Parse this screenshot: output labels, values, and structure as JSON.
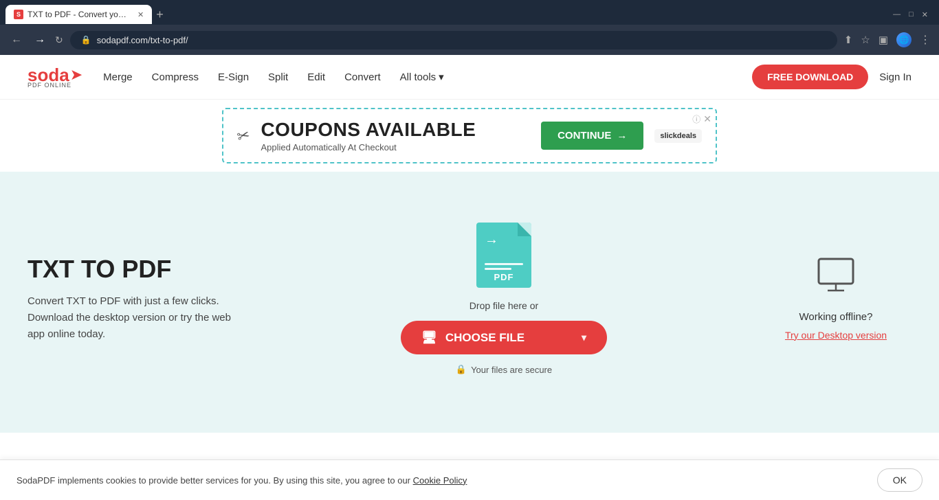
{
  "browser": {
    "tab_title": "TXT to PDF - Convert your TXT t...",
    "tab_favicon": "S",
    "url": "sodapdf.com/txt-to-pdf/",
    "new_tab_label": "+",
    "minimize": "—",
    "maximize": "□",
    "close": "✕"
  },
  "header": {
    "logo_text": "soda",
    "logo_arrow": "➤",
    "logo_sub": "PDF ONLINE",
    "nav": {
      "merge": "Merge",
      "compress": "Compress",
      "esign": "E-Sign",
      "split": "Split",
      "edit": "Edit",
      "convert": "Convert",
      "all_tools": "All tools",
      "dropdown_arrow": "▾"
    },
    "free_download": "FREE DOWNLOAD",
    "sign_in": "Sign In"
  },
  "ad": {
    "scissors": "✂",
    "headline": "COUPONS AVAILABLE",
    "subtext": "Applied Automatically At Checkout",
    "continue_btn": "CONTINUE",
    "continue_arrow": "→",
    "slickdeals": "slickdeals",
    "info": "ⓘ",
    "close": "✕"
  },
  "main": {
    "title": "TXT TO PDF",
    "description": "Convert TXT to PDF with just a few clicks. Download the desktop version or try the web app online today.",
    "drop_text": "Drop file here or",
    "choose_file": "CHOOSE FILE",
    "monitor_icon": "🖥",
    "dropdown_arrow": "▾",
    "secure_text": "Your files are secure",
    "lock_icon": "🔒"
  },
  "offline": {
    "monitor_icon": "🖥",
    "working_offline": "Working offline?",
    "desktop_link": "Try our Desktop version"
  },
  "cookie": {
    "text": "SodaPDF implements cookies to provide better services for you. By using this site, you agree to our",
    "link": "Cookie Policy",
    "ok": "OK"
  }
}
